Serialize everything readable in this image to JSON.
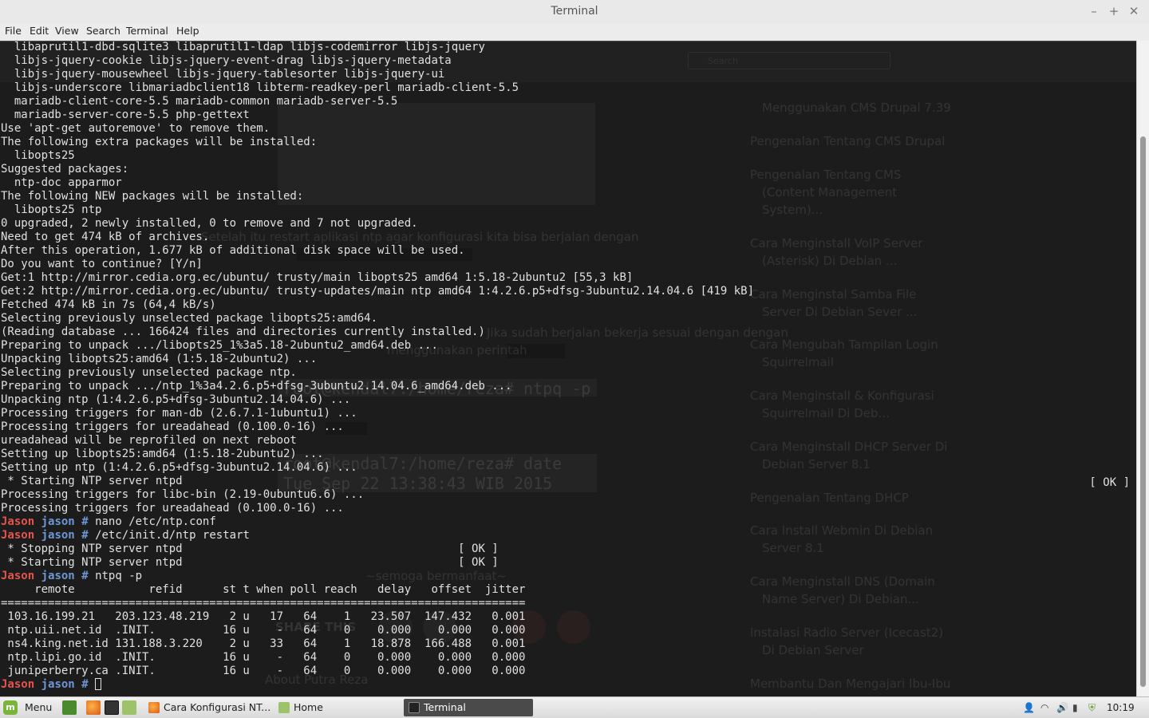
{
  "window": {
    "title": "Terminal",
    "controls": [
      "–",
      "+",
      "✕"
    ]
  },
  "menubar": [
    "File",
    "Edit",
    "View",
    "Search",
    "Terminal",
    "Help"
  ],
  "colors": {
    "prompt_user": "#e4544d",
    "prompt_host": "#6f97d8",
    "terminal_text": "#e0e0e0",
    "mint_green": "#7ab43b"
  },
  "terminal": {
    "lines": [
      {
        "text": "  libaprutil1-dbd-sqlite3 libaprutil1-ldap libjs-codemirror libjs-jquery"
      },
      {
        "text": "  libjs-jquery-cookie libjs-jquery-event-drag libjs-jquery-metadata"
      },
      {
        "text": "  libjs-jquery-mousewheel libjs-jquery-tablesorter libjs-jquery-ui"
      },
      {
        "text": "  libjs-underscore libmariadbclient18 libterm-readkey-perl mariadb-client-5.5"
      },
      {
        "text": "  mariadb-client-core-5.5 mariadb-common mariadb-server-5.5"
      },
      {
        "text": "  mariadb-server-core-5.5 php-gettext"
      },
      {
        "text": "Use 'apt-get autoremove' to remove them."
      },
      {
        "text": "The following extra packages will be installed:"
      },
      {
        "text": "  libopts25"
      },
      {
        "text": "Suggested packages:"
      },
      {
        "text": "  ntp-doc apparmor"
      },
      {
        "text": "The following NEW packages will be installed:"
      },
      {
        "text": "  libopts25 ntp"
      },
      {
        "text": "0 upgraded, 2 newly installed, 0 to remove and 7 not upgraded."
      },
      {
        "text": "Need to get 474 kB of archives."
      },
      {
        "text": "After this operation, 1.677 kB of additional disk space will be used."
      },
      {
        "text": "Do you want to continue? [Y/n]"
      },
      {
        "text": "Get:1 http://mirror.cedia.org.ec/ubuntu/ trusty/main libopts25 amd64 1:5.18-2ubuntu2 [55,3 kB]"
      },
      {
        "text": "Get:2 http://mirror.cedia.org.ec/ubuntu/ trusty-updates/main ntp amd64 1:4.2.6.p5+dfsg-3ubuntu2.14.04.6 [419 kB]"
      },
      {
        "text": "Fetched 474 kB in 7s (64,4 kB/s)"
      },
      {
        "text": "Selecting previously unselected package libopts25:amd64."
      },
      {
        "text": "(Reading database ... 166424 files and directories currently installed.)"
      },
      {
        "text": "Preparing to unpack .../libopts25_1%3a5.18-2ubuntu2_amd64.deb ..."
      },
      {
        "text": "Unpacking libopts25:amd64 (1:5.18-2ubuntu2) ..."
      },
      {
        "text": "Selecting previously unselected package ntp."
      },
      {
        "text": "Preparing to unpack .../ntp_1%3a4.2.6.p5+dfsg-3ubuntu2.14.04.6_amd64.deb ..."
      },
      {
        "text": "Unpacking ntp (1:4.2.6.p5+dfsg-3ubuntu2.14.04.6) ..."
      },
      {
        "text": "Processing triggers for man-db (2.6.7.1-1ubuntu1) ..."
      },
      {
        "text": "Processing triggers for ureadahead (0.100.0-16) ..."
      },
      {
        "text": "ureadahead will be reprofiled on next reboot"
      },
      {
        "text": "Setting up libopts25:amd64 (1:5.18-2ubuntu2) ..."
      },
      {
        "text": "Setting up ntp (1:4.2.6.p5+dfsg-3ubuntu2.14.04.6) ..."
      },
      {
        "text": " * Starting NTP server ntpd"
      },
      {
        "text": "Processing triggers for libc-bin (2.19-0ubuntu6.6) ..."
      },
      {
        "text": "Processing triggers for ureadahead (0.100.0-16) ..."
      },
      {
        "prompt": true,
        "cmd": "nano /etc/ntp.conf"
      },
      {
        "prompt": true,
        "cmd": "/etc/init.d/ntp restart"
      },
      {
        "text": " * Stopping NTP server ntpd                                         [ OK ]"
      },
      {
        "text": " * Starting NTP server ntpd                                         [ OK ]"
      },
      {
        "prompt": true,
        "cmd": "ntpq -p"
      },
      {
        "text": "     remote           refid      st t when poll reach   delay   offset  jitter"
      },
      {
        "text": "=============================================================================="
      },
      {
        "text": " 103.16.199.21   203.123.48.219   2 u   17   64    1   23.507  147.432   0.001"
      },
      {
        "text": " ntp.uii.net.id  .INIT.          16 u    -   64    0    0.000    0.000   0.000"
      },
      {
        "text": " ns4.king.net.id 131.188.3.220    2 u   33   64    1   18.878  166.488   0.001"
      },
      {
        "text": " ntp.lipi.go.id  .INIT.          16 u    -   64    0    0.000    0.000   0.000"
      },
      {
        "text": " juniperberry.ca .INIT.          16 u    -   64    0    0.000    0.000   0.000"
      },
      {
        "prompt": true,
        "cmd": "",
        "cursor": true
      }
    ],
    "prompt_user": "Jason",
    "prompt_host": "jason",
    "prompt_symbol": "#",
    "right_status": "[ OK ]"
  },
  "background_window": {
    "search_placeholder": "Search",
    "sidebar_links": [
      "Menggunakan CMS Drupal 7.39",
      "Pengenalan Tentang CMS Drupal",
      "Pengenalan Tentang CMS",
      "(Content Management",
      "System)...",
      "Cara Menginstall VoIP Server",
      "(Asterisk) Di Debian ...",
      "Cara Menginstal Samba File",
      "Server Di Debian Sever ...",
      "Cara Mengubah Tampilan Login",
      "Squirrelmail",
      "Cara Menginstall & Konfigurasi",
      "Squirrelmail Di Deb...",
      "Cara Menginstall DHCP Server Di",
      "Debian Server 8.1",
      "Pengenalan Tentang DHCP",
      "Cara Install Webmin Di Debian",
      "Server 8.1",
      "Cara Menginstall DNS (Domain",
      "Name Server) Di Debian...",
      "Instalasi Radio Server (Icecast2)",
      "Di Debian Server",
      "Membantu Dan Mengajari Ibu-Ibu"
    ],
    "article_texts": [
      "Setelah itu restart aplikasi ntp agar konfigurasi kita bisa berjalan dengan",
      "Jika sudah berjalan bekerja sesuai dengan dengan",
      "menggunakan perintah",
      "root@kendal7:/home/reza# ntpq -p",
      "root@kendal7:/home/reza# date",
      "Tue Sep 22 13:38:43 WIB 2015",
      "~semoga bermanfaat~",
      "SHARE THIS",
      "About Putra Reza"
    ]
  },
  "taskbar": {
    "menu_label": "Menu",
    "tasks": [
      {
        "label": "Cara Konfigurasi NT...",
        "icon": "firefox-icon"
      },
      {
        "label": "Home",
        "icon": "folder-icon"
      },
      {
        "label": "Terminal",
        "icon": "terminal-icon",
        "active": true
      }
    ],
    "clock": "10:19"
  }
}
